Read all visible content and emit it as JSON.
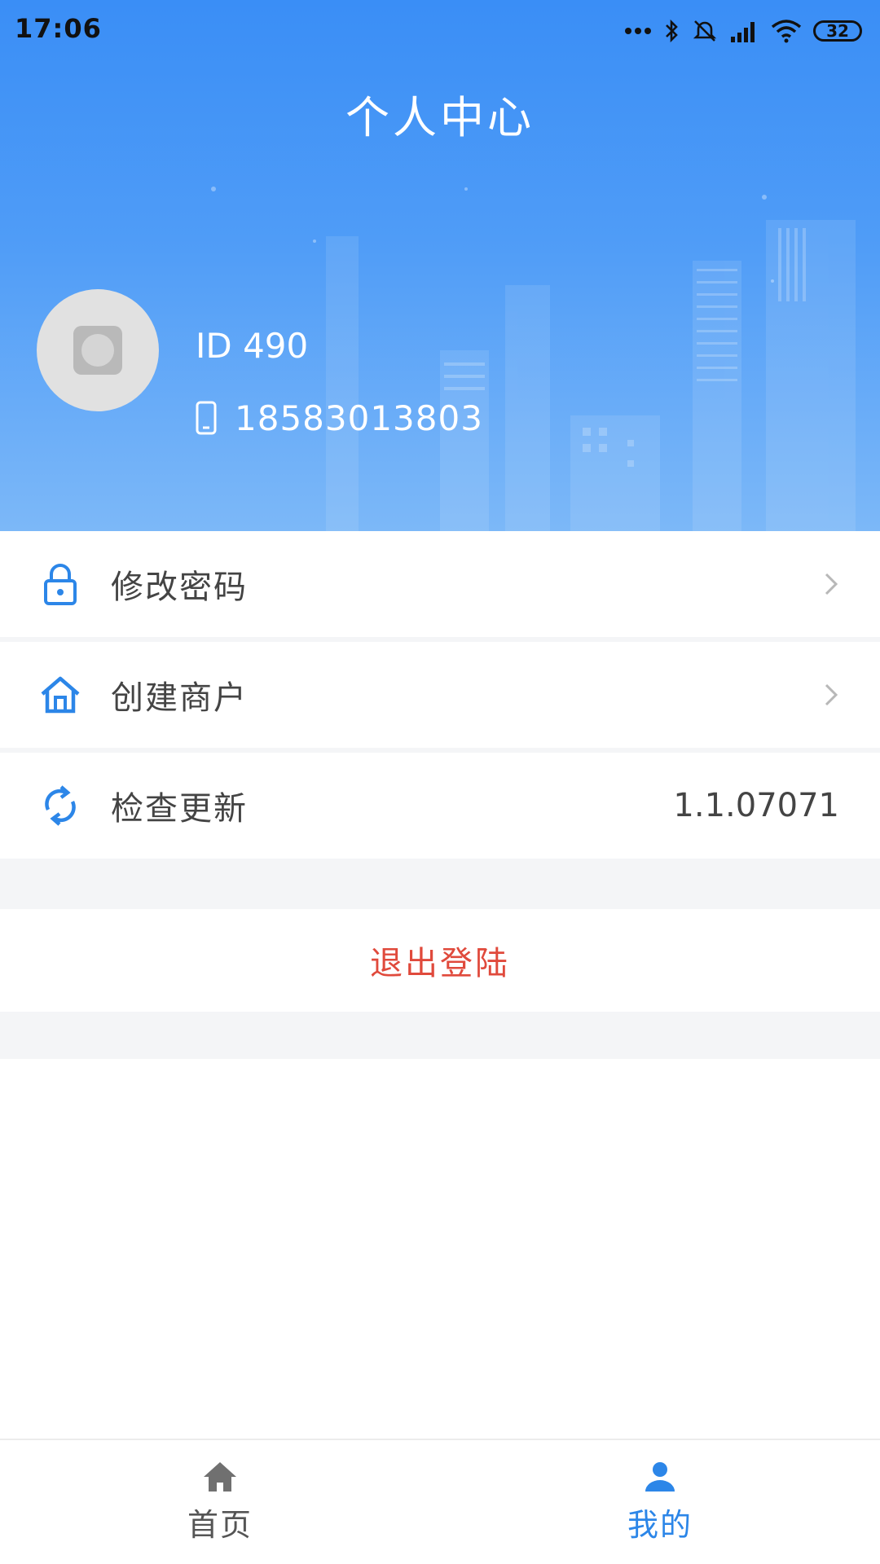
{
  "status_bar": {
    "time": "17:06",
    "battery": "32",
    "icons": [
      "more-dots-icon",
      "bluetooth-icon",
      "mute-icon",
      "signal-icon",
      "wifi-icon",
      "battery-icon"
    ]
  },
  "header": {
    "title": "个人中心",
    "user_id": "ID 490",
    "phone": "18583013803"
  },
  "menu": {
    "items": [
      {
        "label": "修改密码",
        "icon": "lock-icon",
        "right": "chevron-right-icon"
      },
      {
        "label": "创建商户",
        "icon": "house-icon",
        "right": "chevron-right-icon"
      },
      {
        "label": "检查更新",
        "icon": "refresh-icon",
        "value": "1.1.07071"
      }
    ],
    "logout": "退出登陆"
  },
  "bottom_nav": {
    "tabs": [
      {
        "label": "首页",
        "icon": "home-icon",
        "active": false
      },
      {
        "label": "我的",
        "icon": "user-icon",
        "active": true
      }
    ]
  },
  "colors": {
    "header_blue": "#3a8ef6",
    "accent_blue": "#2c86e8",
    "logout_red": "#e04a3c",
    "separator": "#f4f5f7"
  }
}
